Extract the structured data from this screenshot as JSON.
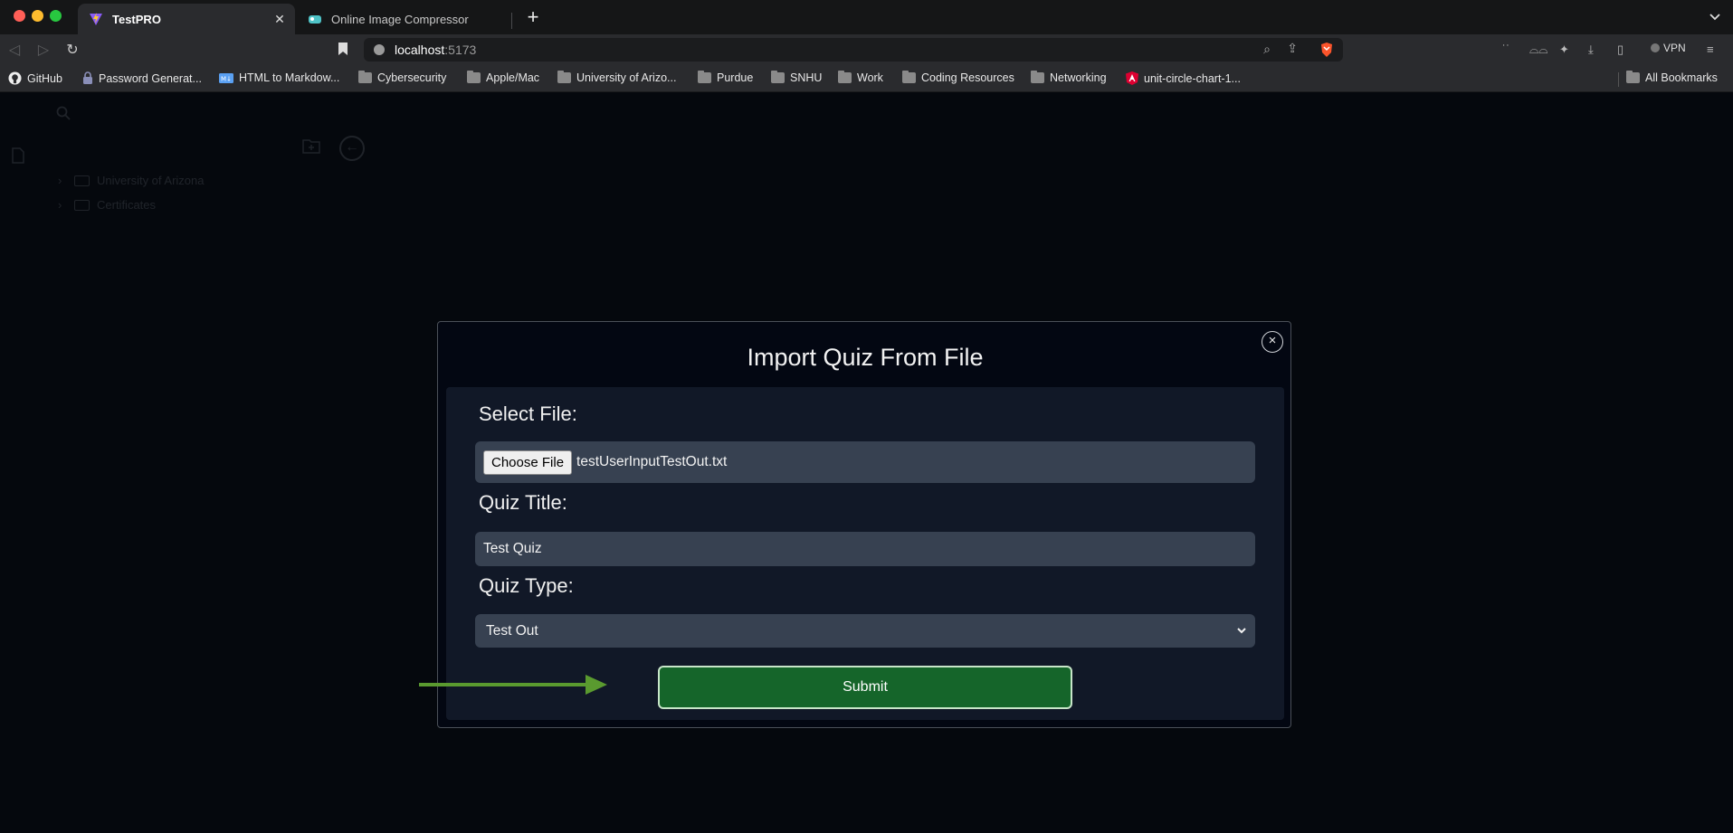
{
  "browser": {
    "tabs": [
      {
        "title": "TestPRO",
        "active": true
      },
      {
        "title": "Online Image Compressor",
        "active": false
      }
    ],
    "url": {
      "host": "localhost",
      "port": ":5173"
    },
    "vpn_label": "VPN",
    "bookmarks": [
      {
        "label": "GitHub",
        "icon": "github-icon"
      },
      {
        "label": "Password Generat...",
        "icon": "lock-icon"
      },
      {
        "label": "HTML to Markdow...",
        "icon": "md-icon"
      },
      {
        "label": "Cybersecurity",
        "icon": "folder-icon"
      },
      {
        "label": "Apple/Mac",
        "icon": "folder-icon"
      },
      {
        "label": "University of Arizo...",
        "icon": "folder-icon"
      },
      {
        "label": "Purdue",
        "icon": "folder-icon"
      },
      {
        "label": "SNHU",
        "icon": "folder-icon"
      },
      {
        "label": "Work",
        "icon": "folder-icon"
      },
      {
        "label": "Coding Resources",
        "icon": "folder-icon"
      },
      {
        "label": "Networking",
        "icon": "folder-icon"
      },
      {
        "label": "unit-circle-chart-1...",
        "icon": "angular-icon"
      }
    ],
    "all_bookmarks": "All Bookmarks"
  },
  "sidebar": {
    "tree": [
      {
        "label": "University of Arizona"
      },
      {
        "label": "Certificates"
      }
    ]
  },
  "modal": {
    "title": "Import Quiz From File",
    "close_glyph": "×",
    "select_file_label": "Select File:",
    "choose_file_button": "Choose File",
    "file_name": "testUserInputTestOut.txt",
    "quiz_title_label": "Quiz Title:",
    "quiz_title_value": "Test Quiz",
    "quiz_type_label": "Quiz Type:",
    "quiz_type_value": "Test Out",
    "submit_label": "Submit"
  },
  "colors": {
    "submit_bg": "#15652a",
    "field_bg": "#374151",
    "panel_bg": "#111827",
    "annotation_arrow": "#5a9a2f"
  }
}
